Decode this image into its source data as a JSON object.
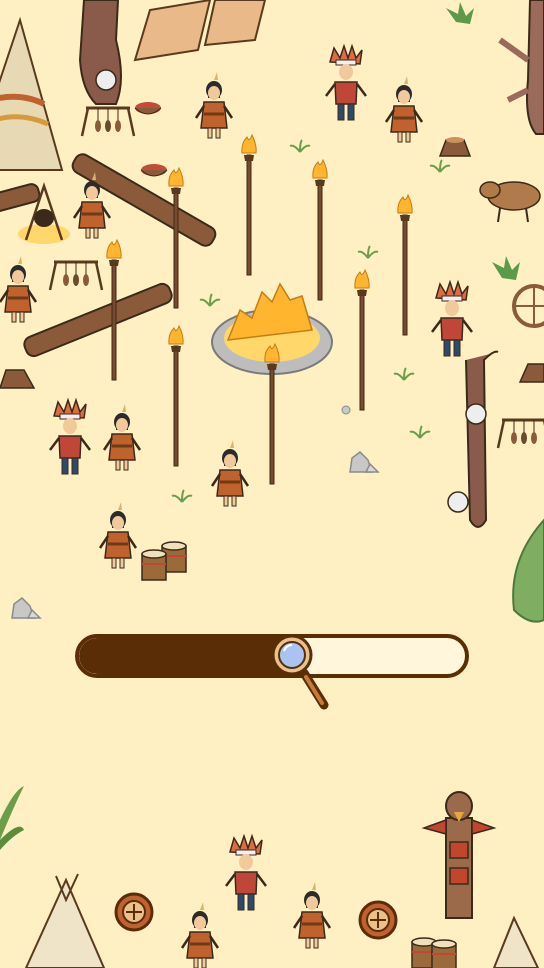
{
  "screen": "loading",
  "colors": {
    "background": "#fff0c4",
    "bar_fill": "#5a2d07",
    "bar_track": "#fff6dc",
    "lens": "#a9c4f2"
  },
  "loading": {
    "progress": 0.56,
    "percent_text": ""
  },
  "icons": {
    "progress_indicator": "magnifying-glass-icon"
  }
}
